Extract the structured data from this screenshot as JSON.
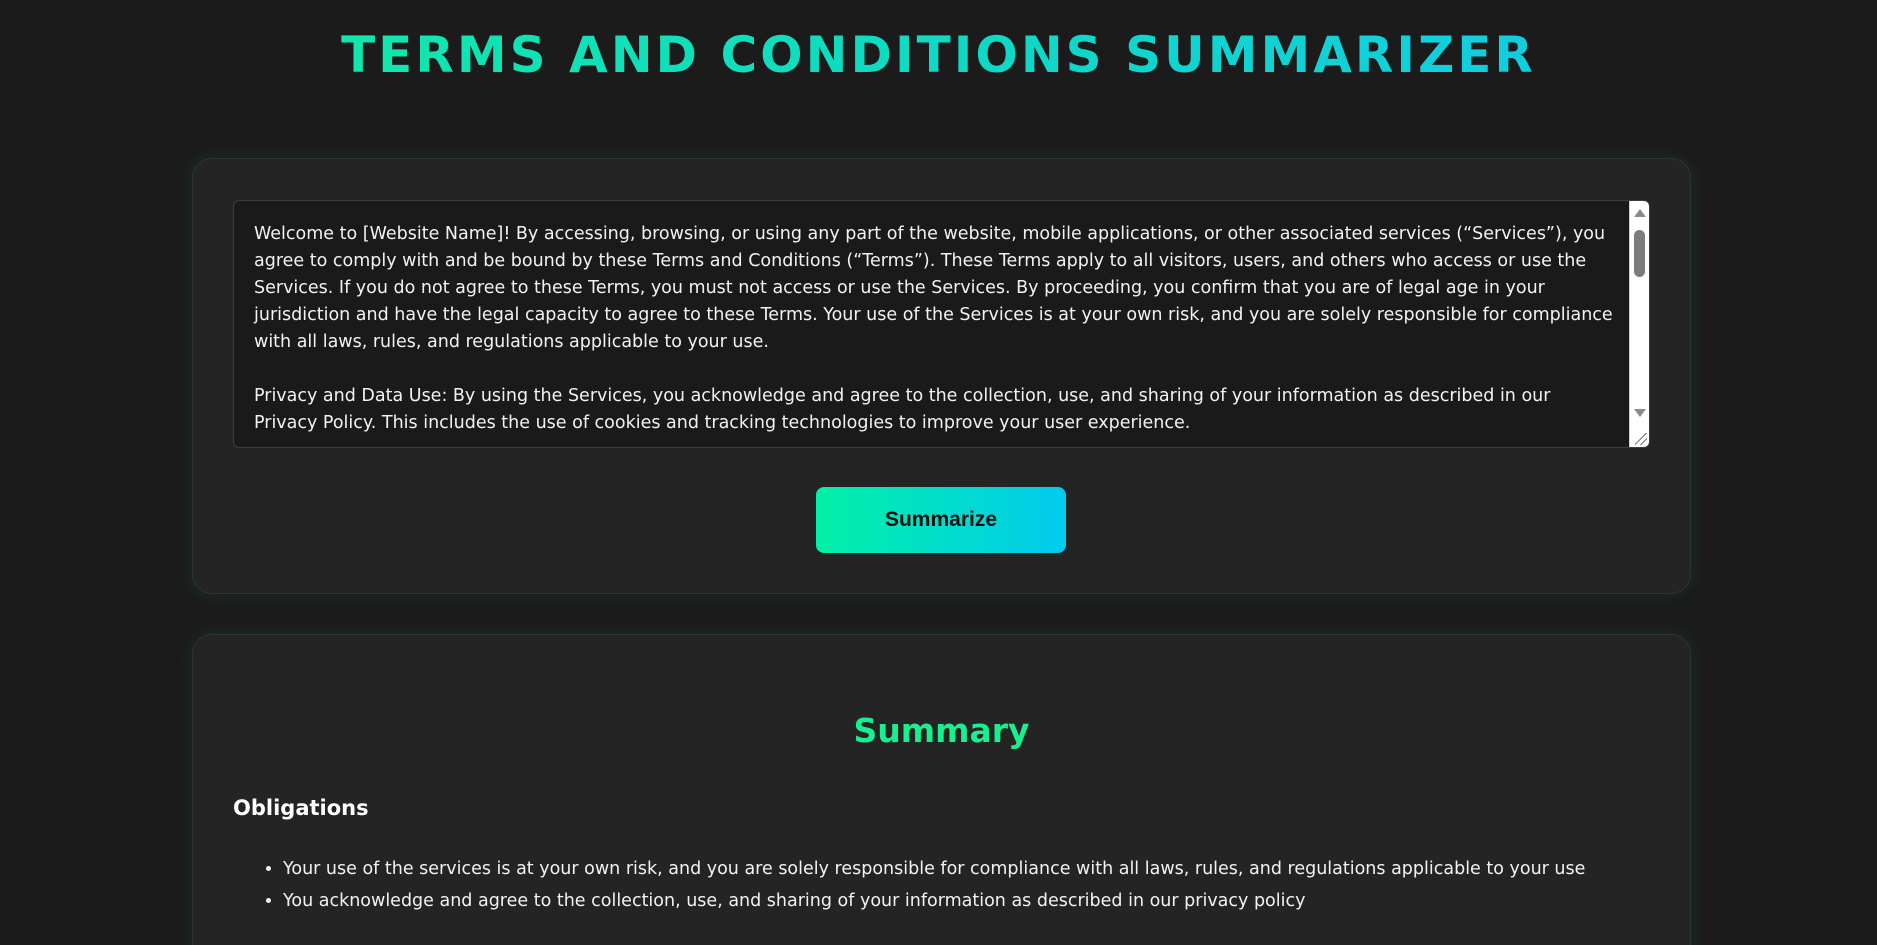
{
  "header": {
    "title": "TERMS AND CONDITIONS SUMMARIZER"
  },
  "input": {
    "paragraphs": [
      "Welcome to [Website Name]! By accessing, browsing, or using any part of the website, mobile applications, or other associated services (“Services”), you agree to comply with and be bound by these Terms and Conditions (“Terms”). These Terms apply to all visitors, users, and others who access or use the Services. If you do not agree to these Terms, you must not access or use the Services. By proceeding, you confirm that you are of legal age in your jurisdiction and have the legal capacity to agree to these Terms. Your use of the Services is at your own risk, and you are solely responsible for compliance with all laws, rules, and regulations applicable to your use.",
      "Privacy and Data Use: By using the Services, you acknowledge and agree to the collection, use, and sharing of your information as described in our Privacy Policy. This includes the use of cookies and tracking technologies to improve your user experience."
    ],
    "button_label": "Summarize"
  },
  "summary": {
    "heading": "Summary",
    "sections": [
      {
        "title": "Obligations",
        "items": [
          "Your use of the services is at your own risk, and you are solely responsible for compliance with all laws, rules, and regulations applicable to your use",
          "You acknowledge and agree to the collection, use, and sharing of your information as described in our privacy policy"
        ]
      }
    ]
  },
  "colors": {
    "background": "#1b1b1b",
    "card": "#242424",
    "accent_green": "#12ee9f",
    "accent_cyan": "#12c7ee"
  }
}
